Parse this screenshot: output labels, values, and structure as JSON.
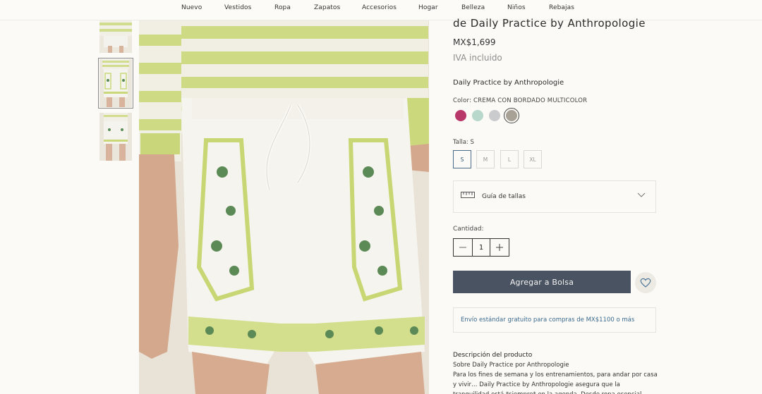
{
  "nav": {
    "items": [
      "Nuevo",
      "Vestidos",
      "Ropa",
      "Zapatos",
      "Accesorios",
      "Hogar",
      "Belleza",
      "Niños",
      "Rebajas"
    ]
  },
  "product": {
    "title": "de Daily Practice by Anthropologie",
    "price": "MX$1,699",
    "tax_note": "IVA incluido",
    "brand": "Daily Practice by Anthropologie",
    "color_label": "Color: CREMA CON BORDADO MULTICOLOR",
    "swatches": [
      "#b9386a",
      "#b7d8cb",
      "#c9cbcd",
      "#a7a196"
    ],
    "selected_swatch": 3,
    "size_label": "Talla: S",
    "sizes": [
      "S",
      "M",
      "L",
      "XL"
    ],
    "selected_size": "S",
    "size_guide_label": "Guía de tallas",
    "quantity_label": "Cantidad:",
    "quantity": "1",
    "add_to_bag": "Agregar a Bolsa",
    "shipping_note": "Envío estándar gratuito para compras de MX$1100 o más",
    "description_heading": "Descripción del producto",
    "description_text": "Sobre Daily Practice por Anthropologie\nPara los fines de semana y los entrenamientos, para andar por casa y vivir… Daily Practice by Anthropologie asegura que la tranquilidad está *siempre* en la agenda. Desde ropa esencial"
  },
  "colors": {
    "accent": "#4a5361",
    "link": "#3b6a8e",
    "lime": "#c9d97a"
  }
}
